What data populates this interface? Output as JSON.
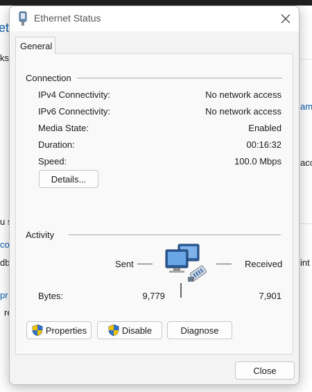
{
  "background": {
    "fragments": [
      "etw",
      "ks",
      "am",
      "acc",
      "u s",
      "co",
      "db",
      "int",
      "pr",
      "re"
    ]
  },
  "dialog": {
    "title": "Ethernet Status",
    "close_glyph": "✕",
    "tab_general": "General",
    "connection": {
      "heading": "Connection",
      "rows": [
        {
          "label": "IPv4 Connectivity:",
          "value": "No network access"
        },
        {
          "label": "IPv6 Connectivity:",
          "value": "No network access"
        },
        {
          "label": "Media State:",
          "value": "Enabled"
        },
        {
          "label": "Duration:",
          "value": "00:16:32"
        },
        {
          "label": "Speed:",
          "value": "100.0 Mbps"
        }
      ],
      "details_button": "Details..."
    },
    "activity": {
      "heading": "Activity",
      "sent_label": "Sent",
      "received_label": "Received",
      "bytes_label": "Bytes:",
      "bytes_sent": "9,779",
      "bytes_received": "7,901"
    },
    "buttons": {
      "properties": "Properties",
      "disable": "Disable",
      "diagnose": "Diagnose",
      "close": "Close"
    },
    "icons": {
      "title": "ethernet-plug-icon",
      "close": "close-icon",
      "network": "network-computers-icon",
      "shield": "uac-shield-icon"
    },
    "colors": {
      "accent": "#0b5cad",
      "shield_blue": "#2f72c8",
      "shield_yellow": "#f2c200"
    }
  }
}
